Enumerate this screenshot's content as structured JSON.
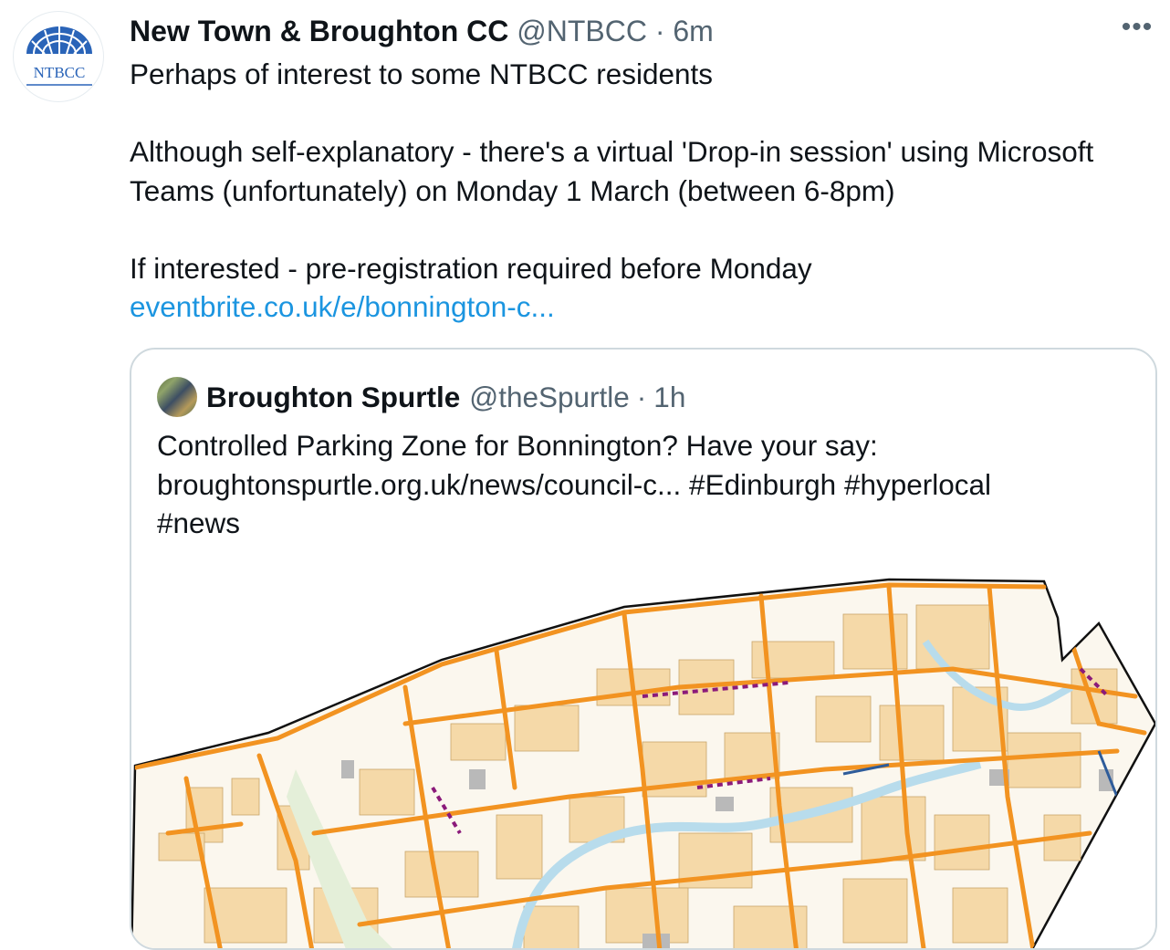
{
  "tweet": {
    "author_name": "New Town & Broughton CC",
    "handle": "@NTBCC",
    "separator": "·",
    "time": "6m",
    "more_label": "•••",
    "avatar_text": "NTBCC",
    "lines": [
      "Perhaps of interest to some NTBCC residents",
      "Although self-explanatory - there's a virtual 'Drop-in session' using Microsoft Teams (unfortunately) on Monday 1 March (between 6-8pm)",
      "If interested - pre-registration required before Monday"
    ],
    "link": "eventbrite.co.uk/e/bonnington-c..."
  },
  "quoted": {
    "author_name": "Broughton Spurtle",
    "handle": "@theSpurtle",
    "separator": "·",
    "time": "1h",
    "text_line1": "Controlled Parking Zone for Bonnington? Have your say:",
    "text_line2": "broughtonspurtle.org.uk/news/council-c... #Edinburgh #hyperlocal",
    "text_line3": "#news",
    "media": "map-image"
  },
  "colors": {
    "link": "#1b95e0",
    "secondary_text": "#536471",
    "card_border": "#cfd9de",
    "map_road": "#f29321",
    "map_building": "#f5d9a8",
    "map_water": "#b8dcec",
    "map_highlight": "#8b1a7a"
  }
}
